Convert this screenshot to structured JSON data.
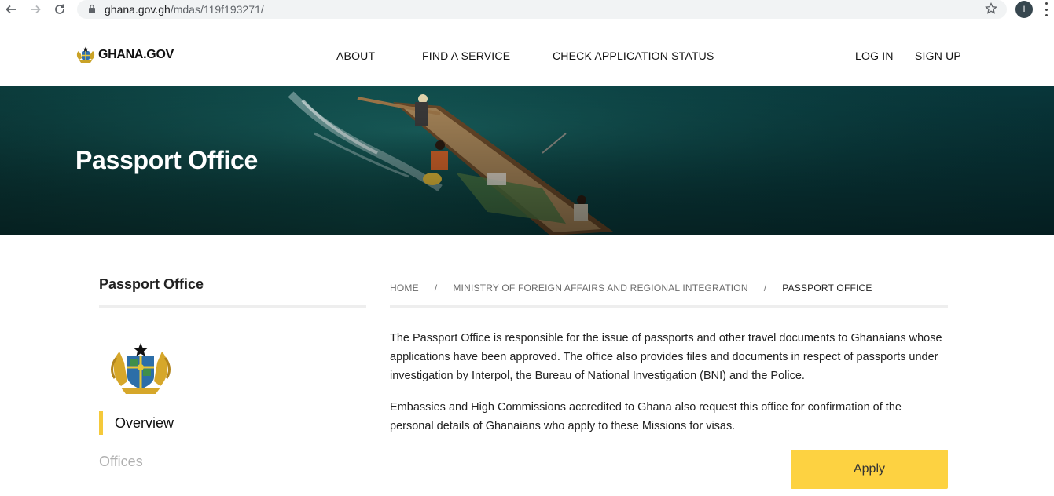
{
  "browser": {
    "url_host": "ghana.gov.gh",
    "url_path": "/mdas/119f193271/",
    "profile_initial": "I"
  },
  "header": {
    "logo_text": "GHANA.GOV",
    "nav": [
      "ABOUT",
      "FIND A SERVICE",
      "CHECK APPLICATION STATUS"
    ],
    "login": "LOG IN",
    "signup": "SIGN UP"
  },
  "hero": {
    "title": "Passport Office"
  },
  "sidebar": {
    "title": "Passport Office",
    "items": [
      "Overview",
      "Offices"
    ]
  },
  "breadcrumb": [
    "HOME",
    "MINISTRY OF FOREIGN AFFAIRS AND REGIONAL INTEGRATION",
    "PASSPORT OFFICE"
  ],
  "breadcrumb_separator": "/",
  "content": {
    "paragraphs": [
      "The Passport Office is responsible for the issue of passports and other travel documents to Ghanaians whose applications have been approved. The office also provides files and documents in respect of passports under investigation by Interpol, the Bureau of National Investigation (BNI) and the Police.",
      "Embassies and High Commissions accredited to Ghana also request this office for confirmation of the personal details of Ghanaians who apply to these Missions for visas."
    ],
    "apply_label": "Apply"
  },
  "colors": {
    "accent": "#fdd241",
    "active_marker": "#f5c93a",
    "hero_sea": "#0e4a48"
  },
  "icons": [
    "back-arrow-icon",
    "forward-arrow-icon",
    "reload-icon",
    "lock-icon",
    "star-icon",
    "menu-icon",
    "coat-of-arms-icon"
  ]
}
